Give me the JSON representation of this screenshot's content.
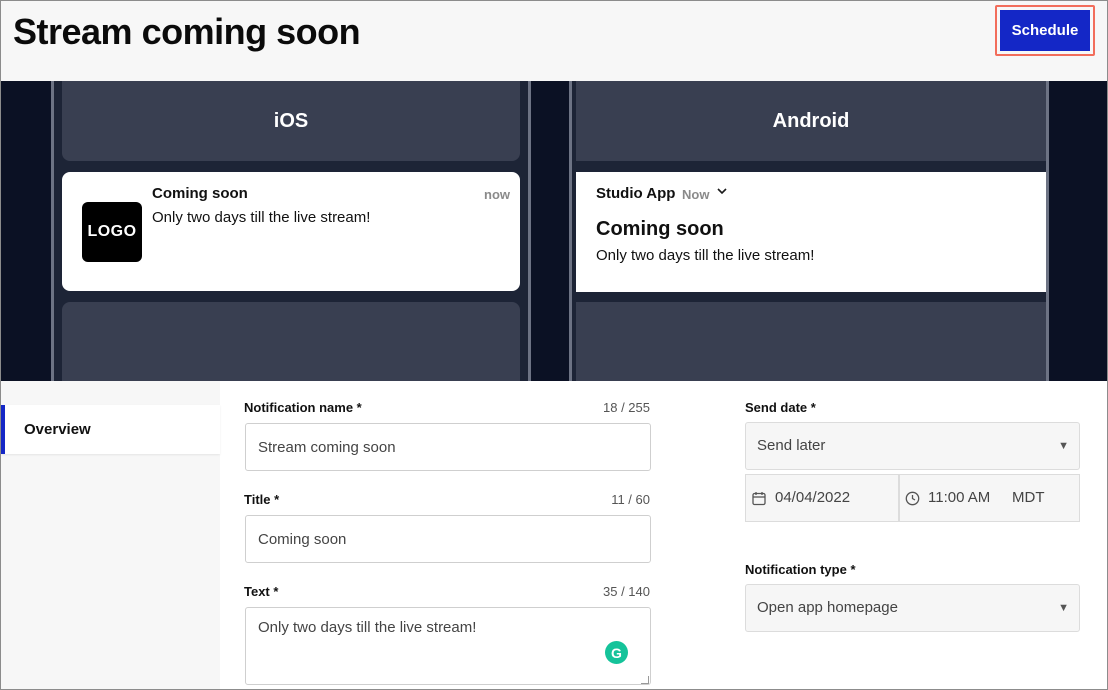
{
  "header": {
    "title": "Stream coming soon",
    "schedule_label": "Schedule"
  },
  "preview": {
    "ios": {
      "tab_label": "iOS",
      "logo_text": "LOGO",
      "title": "Coming soon",
      "time": "now",
      "body": "Only two days till the live stream!"
    },
    "android": {
      "tab_label": "Android",
      "app_name": "Studio App",
      "time": "Now",
      "title": "Coming soon",
      "body": "Only two days till the live stream!"
    }
  },
  "sidebar": {
    "items": [
      {
        "label": "Overview",
        "active": true
      }
    ]
  },
  "form": {
    "notification_name": {
      "label": "Notification name *",
      "counter": "18 / 255",
      "value": "Stream coming soon"
    },
    "title": {
      "label": "Title *",
      "counter": "11 / 60",
      "value": "Coming soon"
    },
    "text": {
      "label": "Text *",
      "counter": "35 / 140",
      "value": "Only two days till the live stream!"
    },
    "send_date": {
      "label": "Send date *",
      "selected": "Send later",
      "date": "04/04/2022",
      "time": "11:00 AM",
      "timezone": "MDT"
    },
    "notification_type": {
      "label": "Notification type *",
      "selected": "Open app homepage"
    }
  },
  "colors": {
    "accent": "#1427c6",
    "preview_bg": "#0b1124",
    "preview_panel": "#393f51",
    "highlight_border": "#f26d5b"
  },
  "icons": [
    "chevron-down-icon",
    "calendar-icon",
    "clock-icon",
    "caret-down-icon",
    "grammarly-icon"
  ]
}
